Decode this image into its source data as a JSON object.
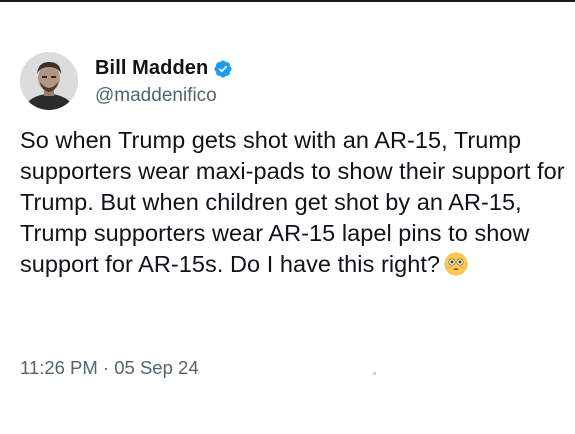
{
  "author": {
    "display_name": "Bill Madden",
    "handle": "@maddenifico",
    "verified": true,
    "avatar_icon": "profile-photo",
    "verified_color": "#1d9bf0"
  },
  "post": {
    "text": "So when Trump gets shot with an AR-15, Trump supporters wear maxi-pads to show their support for Trump. But when children get shot by an AR-15, Trump supporters wear AR-15 lapel pins to show support for AR-15s. Do I have this right?",
    "emoji_icon": "flushed-face-icon",
    "timestamp": "11:26 PM · 05 Sep 24"
  },
  "colors": {
    "text": "#0f1419",
    "secondary": "#536471",
    "background": "#ffffff"
  }
}
